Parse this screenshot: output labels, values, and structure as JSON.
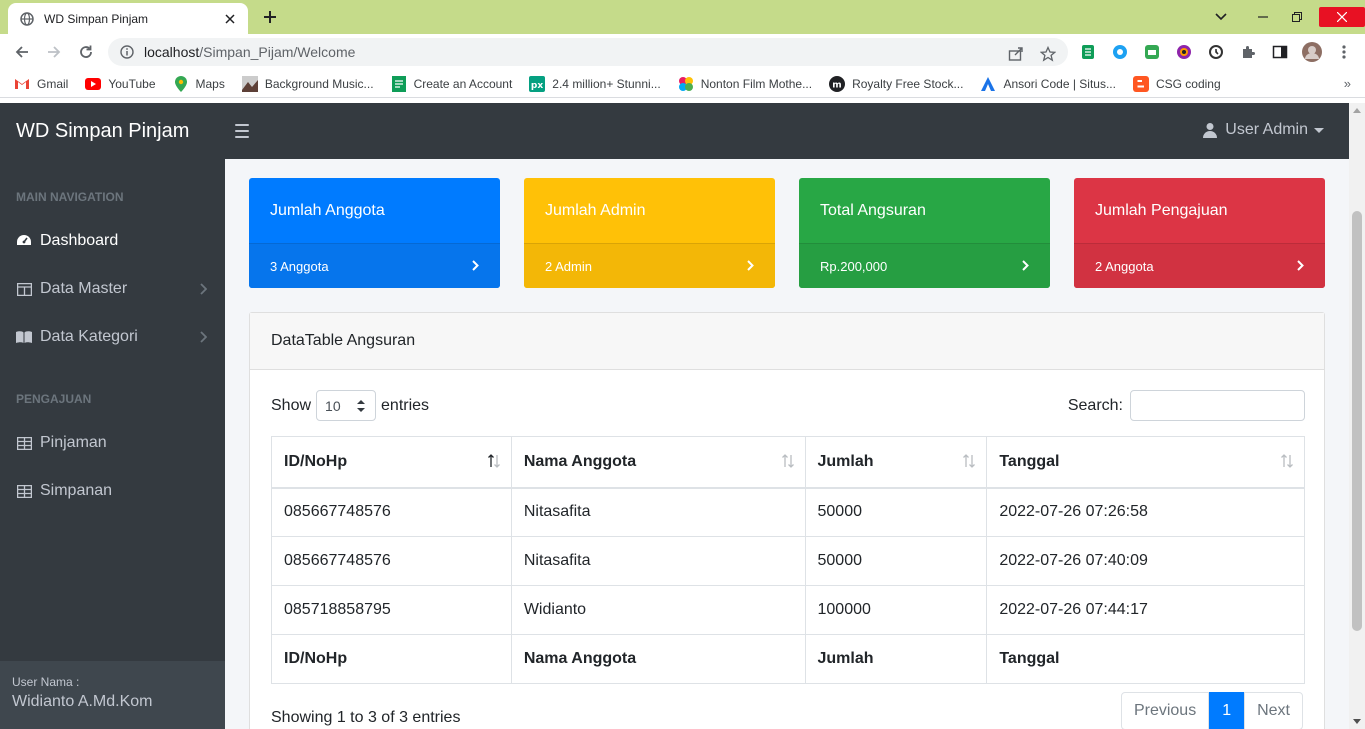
{
  "browser": {
    "tab_title": "WD Simpan Pinjam",
    "url_host": "localhost",
    "url_path": "/Simpan_Pijam/Welcome",
    "bookmarks": [
      {
        "label": "Gmail",
        "icon": "gmail-icon",
        "color": "#ea4335"
      },
      {
        "label": "YouTube",
        "icon": "youtube-icon",
        "color": "#ff0000"
      },
      {
        "label": "Maps",
        "icon": "maps-icon",
        "color": "#34a853"
      },
      {
        "label": "Background Music...",
        "icon": "image-icon",
        "color": "#5d4037"
      },
      {
        "label": "Create an Account",
        "icon": "doc-icon",
        "color": "#0f9d58"
      },
      {
        "label": "2.4 million+ Stunni...",
        "icon": "px-icon",
        "color": "#05a081"
      },
      {
        "label": "Nonton Film Mothe...",
        "icon": "pinwheel-icon",
        "color": "#e91e63"
      },
      {
        "label": "Royalty Free Stock...",
        "icon": "m-icon",
        "color": "#202124"
      },
      {
        "label": "Ansori Code | Situs...",
        "icon": "a-icon",
        "color": "#1a73e8"
      },
      {
        "label": "CSG coding",
        "icon": "blogger-icon",
        "color": "#ff5722"
      }
    ]
  },
  "app": {
    "brand": "WD Simpan Pinjam",
    "user": "User Admin",
    "sidebar": {
      "section_main": "MAIN NAVIGATION",
      "items_main": [
        {
          "label": "Dashboard",
          "icon": "dashboard-icon",
          "active": true
        },
        {
          "label": "Data Master",
          "icon": "table-icon",
          "chevron": true
        },
        {
          "label": "Data Kategori",
          "icon": "book-icon",
          "chevron": true
        }
      ],
      "section_pengajuan": "PENGAJUAN",
      "items_pengajuan": [
        {
          "label": "Pinjaman",
          "icon": "grid-icon"
        },
        {
          "label": "Simpanan",
          "icon": "grid-icon"
        }
      ],
      "footer_label": "User Nama :",
      "footer_name": "Widianto A.Md.Kom"
    },
    "cards": [
      {
        "title": "Jumlah Anggota",
        "value": "3 Anggota",
        "color": "#007bff"
      },
      {
        "title": "Jumlah Admin",
        "value": "2 Admin",
        "color": "#ffc107"
      },
      {
        "title": "Total Angsuran",
        "value": "Rp.200,000",
        "color": "#28a745"
      },
      {
        "title": "Jumlah Pengajuan",
        "value": "2 Anggota",
        "color": "#dc3545"
      }
    ],
    "datatable": {
      "title": "DataTable Angsuran",
      "show_label": "Show",
      "entries_value": "10",
      "entries_label": "entries",
      "search_label": "Search:",
      "columns": [
        "ID/NoHp",
        "Nama Anggota",
        "Jumlah",
        "Tanggal"
      ],
      "rows": [
        [
          "085667748576",
          "Nitasafita",
          "50000",
          "2022-07-26 07:26:58"
        ],
        [
          "085667748576",
          "Nitasafita",
          "50000",
          "2022-07-26 07:40:09"
        ],
        [
          "085718858795",
          "Widianto",
          "100000",
          "2022-07-26 07:44:17"
        ]
      ],
      "info": "Showing 1 to 3 of 3 entries",
      "pagination": {
        "previous": "Previous",
        "current": "1",
        "next": "Next"
      }
    }
  }
}
